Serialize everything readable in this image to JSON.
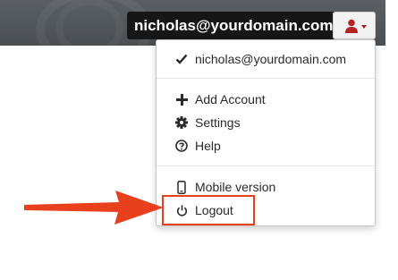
{
  "header": {
    "user_email": "nicholas@yourdomain.com",
    "user_menu_icon": "user-icon",
    "caret_icon": "caret-down-icon"
  },
  "menu": {
    "current_account": "nicholas@yourdomain.com",
    "current_account_icon": "checkmark-icon",
    "items": [
      {
        "label": "Add Account",
        "icon": "plus-icon"
      },
      {
        "label": "Settings",
        "icon": "gear-icon"
      },
      {
        "label": "Help",
        "icon": "question-circle-icon"
      }
    ],
    "mobile_version": {
      "label": "Mobile version",
      "icon": "mobile-icon"
    },
    "logout": {
      "label": "Logout",
      "icon": "power-icon"
    }
  },
  "annotation": {
    "highlight_color": "#e8401c",
    "arrow_color": "#e8401c"
  },
  "colors": {
    "topbar": "#52575b",
    "user_icon": "#b52424"
  }
}
